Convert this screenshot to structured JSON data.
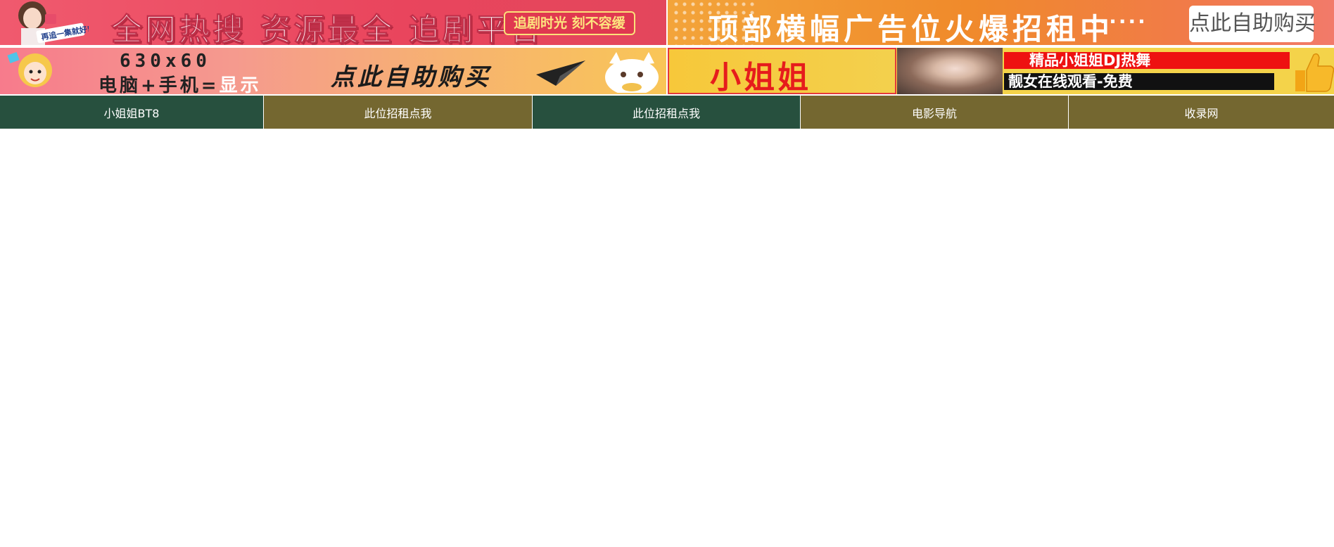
{
  "ads": {
    "top_left": {
      "badge_text": "再追一集就好!",
      "headline": "全网热搜 资源最全 追剧平台",
      "tag": "追剧时光 刻不容缓"
    },
    "top_right": {
      "headline": "顶部横幅广告位火爆招租中",
      "dots": "······",
      "button_label": "点此自助购买"
    },
    "second_left": {
      "size_text": "630x60",
      "device_text_a": "电脑+手机=",
      "device_text_b": "显示",
      "script_text": "点此自助购买"
    },
    "second_right": {
      "brand": "小姐姐",
      "line1": "精品小姐姐DJ热舞",
      "line2": "靓女在线观看-免费"
    }
  },
  "nav": {
    "items": [
      {
        "label": "小姐姐BT8",
        "color": "#27503e"
      },
      {
        "label": "此位招租点我",
        "color": "#746730"
      },
      {
        "label": "此位招租点我",
        "color": "#27503e"
      },
      {
        "label": "电影导航",
        "color": "#746730"
      },
      {
        "label": "收录网",
        "color": "#746730"
      }
    ]
  },
  "colors": {
    "nav_green": "#27503e",
    "nav_olive": "#746730"
  }
}
